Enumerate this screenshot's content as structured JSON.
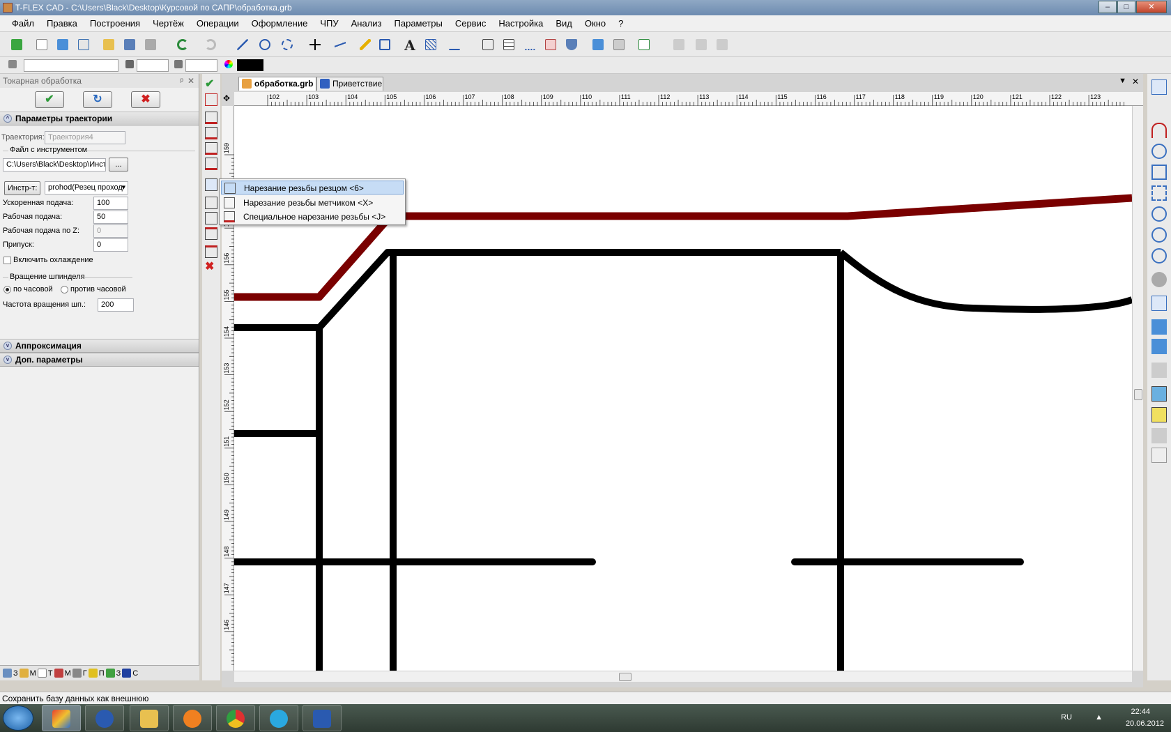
{
  "window": {
    "title": "T-FLEX CAD - C:\\Users\\Black\\Desktop\\Курсовой по САПР\\обработка.grb"
  },
  "menu": [
    "Файл",
    "Правка",
    "Построения",
    "Чертёж",
    "Операции",
    "Оформление",
    "ЧПУ",
    "Анализ",
    "Параметры",
    "Сервис",
    "Настройка",
    "Вид",
    "Окно",
    "?"
  ],
  "panel": {
    "title": "Токарная обработка",
    "sections": {
      "trajectory": "Параметры траектории",
      "approx": "Аппроксимация",
      "extra": "Доп. параметры"
    },
    "trajectory_label": "Траектория:",
    "trajectory_value": "Траектория4",
    "tool_file_label": "Файл с инструментом",
    "tool_file_value": "C:\\Users\\Black\\Desktop\\Инстр",
    "browse_label": "...",
    "tool_button": "Инстр-т:",
    "tool_select": "prohod(Резец проход",
    "fast_feed_label": "Ускоренная подача:",
    "fast_feed": "100",
    "work_feed_label": "Рабочая подача:",
    "work_feed": "50",
    "work_feed_z_label": "Рабочая подача по Z:",
    "work_feed_z": "0",
    "allowance_label": "Припуск:",
    "allowance": "0",
    "cooling_label": "Включить охлаждение",
    "spindle_group": "Вращение шпинделя",
    "cw_label": "по часовой",
    "ccw_label": "против часовой",
    "spindle_speed_label": "Частота вращения шп.:",
    "spindle_speed": "200",
    "bottom_tabs": [
      "З",
      "М",
      "Т",
      "М",
      "Г",
      "П",
      "З",
      "С"
    ]
  },
  "tabs": [
    {
      "label": "обработка.grb"
    },
    {
      "label": "Приветствие"
    }
  ],
  "ruler_h": [
    "102",
    "103",
    "104",
    "105",
    "106",
    "107",
    "108",
    "109",
    "110",
    "111",
    "112",
    "113",
    "114",
    "115",
    "116",
    "117",
    "118",
    "119",
    "120",
    "121",
    "122",
    "123"
  ],
  "ruler_v": [
    "159",
    "158",
    "157",
    "156",
    "155",
    "154",
    "153",
    "152",
    "151",
    "150",
    "149",
    "148",
    "147",
    "146"
  ],
  "popup": [
    {
      "label": "Нарезание резьбы резцом <6>"
    },
    {
      "label": "Нарезание резьбы метчиком <X>"
    },
    {
      "label": "Специальное нарезание резьбы <J>"
    }
  ],
  "status": "Сохранить базу данных как внешнюю",
  "tray": {
    "lang": "RU",
    "time": "22:44",
    "date": "20.06.2012"
  },
  "colors": {
    "trajectory": "#7a0000",
    "geometry": "#000000",
    "accent": "#2e7d32"
  }
}
